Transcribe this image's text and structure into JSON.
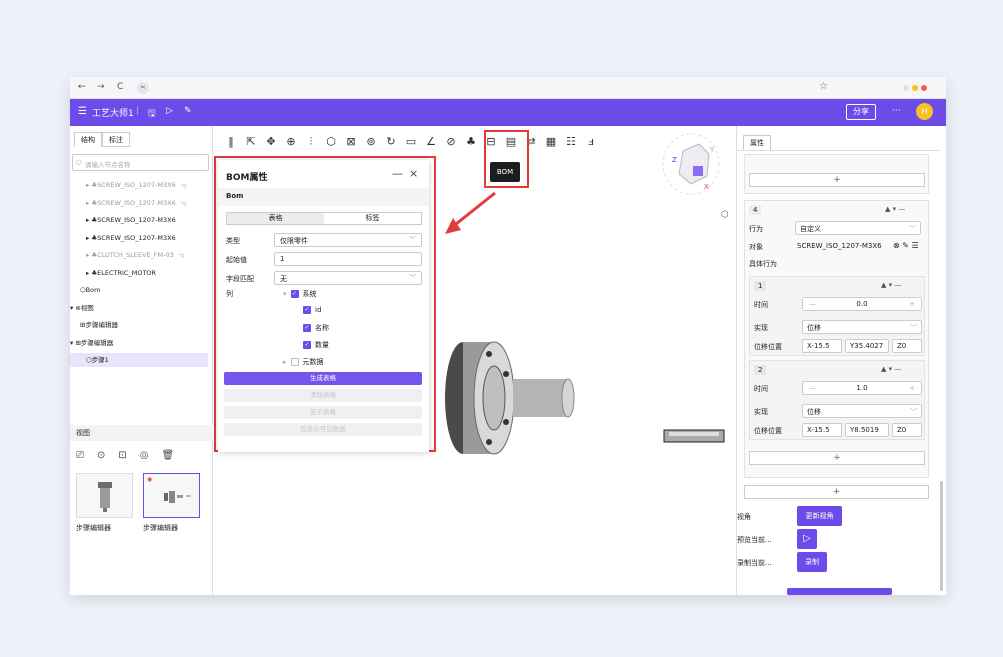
{
  "browser": {
    "back": "←",
    "forward": "→",
    "reload": "C",
    "site_info": "≒",
    "bookmark": "☆",
    "window_dots": [
      "#e0e0e0",
      "#f5c220",
      "#ee5d4f"
    ]
  },
  "app": {
    "menu": "☰",
    "title": "工艺大师1",
    "save": "🖫",
    "play": "▷",
    "edit": "✎",
    "share": "分享",
    "more": "···",
    "avatar": "H",
    "accent": "#6d4be8"
  },
  "left": {
    "tabs": [
      "结构",
      "标注"
    ],
    "search_placeholder": "请输入节点名称",
    "tree": [
      {
        "label": "▸ ♣SCREW_ISO_1207-M3X6",
        "suffix": "ఌ",
        "gray": true
      },
      {
        "label": "▸ ♣SCREW_ISO_1207-M3X6",
        "suffix": "ఌ",
        "gray": true
      },
      {
        "label": "▸ ♣SCREW_ISO_1207-M3X6",
        "suffix": "",
        "gray": false
      },
      {
        "label": "▸ ♣SCREW_ISO_1207-M3X6",
        "suffix": "",
        "gray": false
      },
      {
        "label": "▸ ♣CLUTCH_SLEEVE_FM-03",
        "suffix": "ఌ",
        "gray": true
      },
      {
        "label": "▸ ♣ELECTRIC_MOTOR",
        "suffix": "",
        "gray": false
      },
      {
        "label": "⬡Bom",
        "suffix": "",
        "gray": false
      },
      {
        "label": "▾ ⊚视图",
        "suffix": "",
        "gray": false
      },
      {
        "label": "⊞步骤编辑器",
        "suffix": "",
        "gray": false
      },
      {
        "label": "▾ ⊞步骤编辑器",
        "suffix": "",
        "gray": false
      },
      {
        "label": "⬡步骤1",
        "suffix": "",
        "gray": false
      }
    ],
    "view_section": "视图",
    "view_icons": [
      "⎚",
      "⊙",
      "⊡",
      "◎",
      "🗑"
    ],
    "thumbs": [
      {
        "caption": "步骤编辑器"
      },
      {
        "caption": "步骤编辑器"
      }
    ]
  },
  "toolbar": {
    "icons": [
      "‖",
      "⇱",
      "✥",
      "⊕",
      "⫶",
      "⬡",
      "⊠",
      "⊚",
      "↻",
      "▭",
      "∠",
      "⊘",
      "♣",
      "⊟",
      "▤",
      "⇄",
      "▦",
      "☷",
      "ⅎ"
    ],
    "tooltip": "BOM"
  },
  "bom_panel": {
    "title": "BOM属性",
    "minimize": "—",
    "close": "×",
    "subtitle": "Bom",
    "tabs": [
      "表格",
      "标签"
    ],
    "fields": [
      {
        "label": "类型",
        "value": "仅限零件",
        "dropdown": true
      },
      {
        "label": "起始值",
        "value": "1",
        "dropdown": false
      },
      {
        "label": "字段匹配",
        "value": "无",
        "dropdown": true
      }
    ],
    "columns_label": "列",
    "columns": [
      {
        "label": "系统",
        "checked": true,
        "arrow": "▾"
      },
      {
        "label": "id",
        "checked": true,
        "arrow": ""
      },
      {
        "label": "名称",
        "checked": true,
        "arrow": ""
      },
      {
        "label": "数量",
        "checked": true,
        "arrow": ""
      },
      {
        "label": "元数据",
        "checked": false,
        "arrow": "▸"
      }
    ],
    "buttons": [
      {
        "label": "生成表格",
        "enabled": true
      },
      {
        "label": "清除表格",
        "enabled": false
      },
      {
        "label": "显示表格",
        "enabled": false
      },
      {
        "label": "仅显示可见数据",
        "enabled": false
      }
    ]
  },
  "right": {
    "tab": "属性",
    "add": "+",
    "behavior": {
      "index": "4",
      "label": "行为",
      "value": "自定义",
      "object_label": "对象",
      "object_value": "SCREW_ISO_1207-M3X6",
      "object_icons": "⊗ ✎ ☰",
      "detail_label": "具体行为"
    },
    "items": [
      {
        "index": "1",
        "time_label": "时间",
        "time": "0.0",
        "impl_label": "实现",
        "impl": "位移",
        "pos_label": "位移位置",
        "x": "X-15.5",
        "y": "Y35.4027",
        "z": "Z0"
      },
      {
        "index": "2",
        "time_label": "时间",
        "time": "1.0",
        "impl_label": "实现",
        "impl": "位移",
        "pos_label": "位移位置",
        "x": "X-15.5",
        "y": "Y8.5019",
        "z": "Z0"
      }
    ],
    "arrows": "▲ ▾ —",
    "view_angle_label": "视角",
    "update_view": "更新视角",
    "preview_label": "预览当前...",
    "preview_icon": "▷",
    "record_label": "录制当前...",
    "record": "录制"
  }
}
